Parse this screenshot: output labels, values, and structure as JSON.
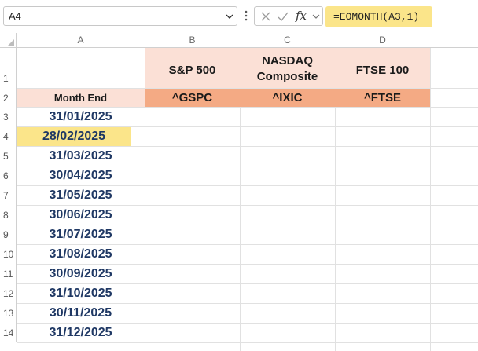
{
  "formula_bar": {
    "name_box": "A4",
    "formula": "=EOMONTH(A3,1)",
    "fx_label": "fx"
  },
  "colors": {
    "header_light": "#fbe0d6",
    "header_dark": "#f4aa84",
    "selection": "#fbe58a",
    "date_text": "#1f3864"
  },
  "columns": [
    "A",
    "B",
    "C",
    "D"
  ],
  "rows": [
    "1",
    "2",
    "3",
    "4",
    "5",
    "6",
    "7",
    "8",
    "9",
    "10",
    "11",
    "12",
    "13",
    "14"
  ],
  "sheet": {
    "b1": "S&P 500",
    "c1_line1": "NASDAQ",
    "c1_line2": "Composite",
    "d1": "FTSE 100",
    "a2": "Month End",
    "b2": "^GSPC",
    "c2": "^IXIC",
    "d2": "^FTSE",
    "dates": [
      "31/01/2025",
      "28/02/2025",
      "31/03/2025",
      "30/04/2025",
      "31/05/2025",
      "30/06/2025",
      "31/07/2025",
      "31/08/2025",
      "30/09/2025",
      "31/10/2025",
      "30/11/2025",
      "31/12/2025"
    ]
  }
}
